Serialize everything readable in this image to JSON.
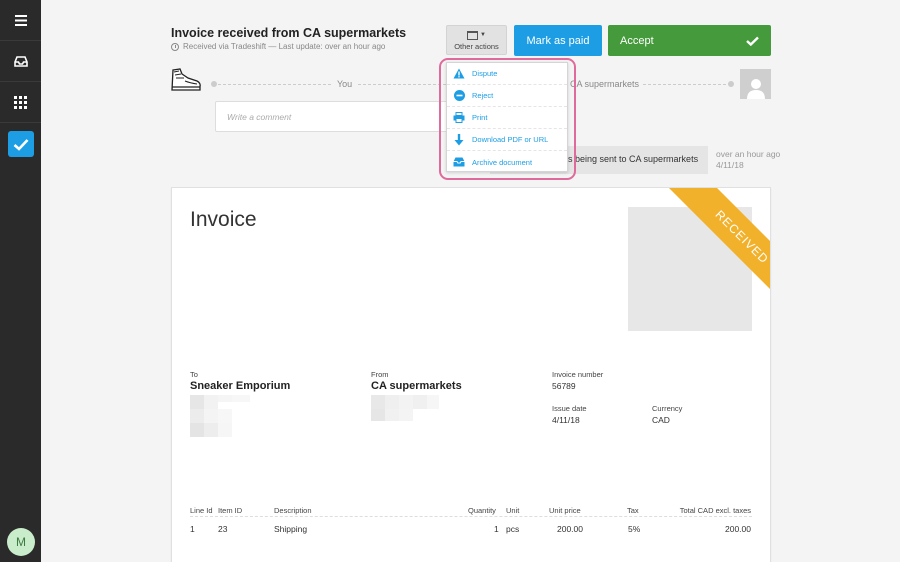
{
  "sidebar": {
    "avatar_initial": "M"
  },
  "header": {
    "title": "Invoice received from CA supermarkets",
    "subtitle": "Received via Tradeshift — Last update: over an hour ago",
    "other_actions_label": "Other actions",
    "mark_paid_label": "Mark as paid",
    "accept_label": "Accept"
  },
  "conversation": {
    "you_label": "You",
    "counterparty_label": "CA supermarkets",
    "comment_placeholder": "Write a comment",
    "message_text": "s being sent to CA supermarkets",
    "message_time": "over an hour ago",
    "message_date": "4/11/18"
  },
  "dropdown": {
    "items": [
      {
        "label": "Dispute",
        "icon": "warning-icon"
      },
      {
        "label": "Reject",
        "icon": "minus-circle-icon"
      },
      {
        "label": "Print",
        "icon": "printer-icon"
      },
      {
        "label": "Download PDF or URL",
        "icon": "download-icon"
      },
      {
        "label": "Archive document",
        "icon": "archive-icon"
      }
    ]
  },
  "invoice": {
    "title": "Invoice",
    "ribbon": "RECEIVED",
    "to_label": "To",
    "to_name": "Sneaker Emporium",
    "from_label": "From",
    "from_name": "CA supermarkets",
    "invoice_number_label": "Invoice number",
    "invoice_number": "56789",
    "issue_date_label": "Issue date",
    "issue_date": "4/11/18",
    "currency_label": "Currency",
    "currency": "CAD",
    "columns": [
      "Line Id",
      "Item ID",
      "Description",
      "Quantity",
      "Unit",
      "Unit price",
      "Tax",
      "Total CAD excl. taxes"
    ],
    "rows": [
      {
        "line_id": "1",
        "item_id": "23",
        "description": "Shipping",
        "quantity": "1",
        "unit": "pcs",
        "unit_price": "200.00",
        "tax": "5%",
        "total": "200.00"
      }
    ]
  },
  "colors": {
    "sidebar": "#2a2a2a",
    "primary_blue": "#1d9ee4",
    "accept_green": "#459a3b",
    "ribbon_orange": "#f2b12a",
    "highlight_pink": "#e06a9c"
  }
}
